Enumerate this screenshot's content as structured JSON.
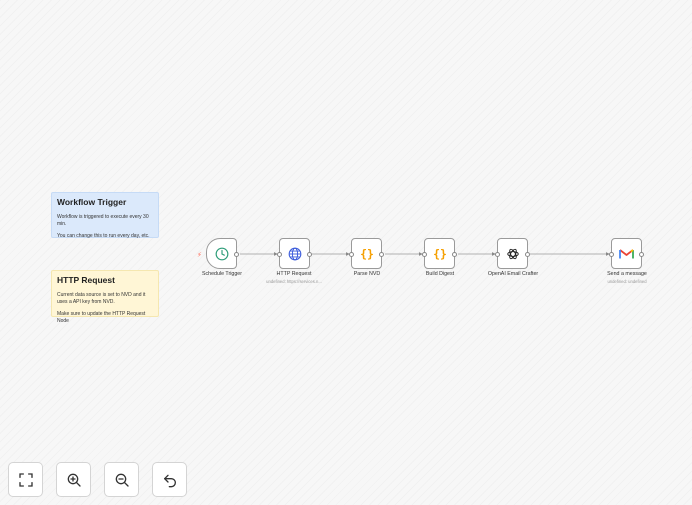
{
  "stickies": {
    "trigger": {
      "title": "Workflow Trigger",
      "lines": [
        "Workflow is triggered to execute every 30 min.",
        "You can change this to run every day, etc."
      ]
    },
    "http": {
      "title": "HTTP Request",
      "lines": [
        "Current data source is set to NVD and it uses a API key from NVD.",
        "Make sure to update the HTTP Request Node"
      ]
    }
  },
  "nodes": {
    "schedule": {
      "label": "Schedule Trigger",
      "icon": "clock-icon",
      "color": "#2f9e7a"
    },
    "http": {
      "label": "HTTP Request",
      "subtitle": "undefined: https://services.n...",
      "icon": "globe-icon",
      "color": "#3b5bdb"
    },
    "parse": {
      "label": "Parse NVD",
      "icon": "braces-icon",
      "color": "#f59f00"
    },
    "digest": {
      "label": "Build Digest",
      "icon": "braces-icon",
      "color": "#f59f00"
    },
    "openai": {
      "label": "OpenAI Email Crafter",
      "icon": "openai-icon",
      "color": "#222222"
    },
    "gmail": {
      "label": "Send a message",
      "subtitle": "undefined: undefined",
      "icon": "gmail-icon"
    }
  },
  "controls": {
    "fit": {
      "icon": "fit-view-icon"
    },
    "zoom_in": {
      "icon": "zoom-in-icon"
    },
    "zoom_out": {
      "icon": "zoom-out-icon"
    },
    "undo": {
      "icon": "undo-icon"
    }
  },
  "colors": {
    "accent": "#ff6d5a",
    "edge": "#9a9a9a"
  }
}
